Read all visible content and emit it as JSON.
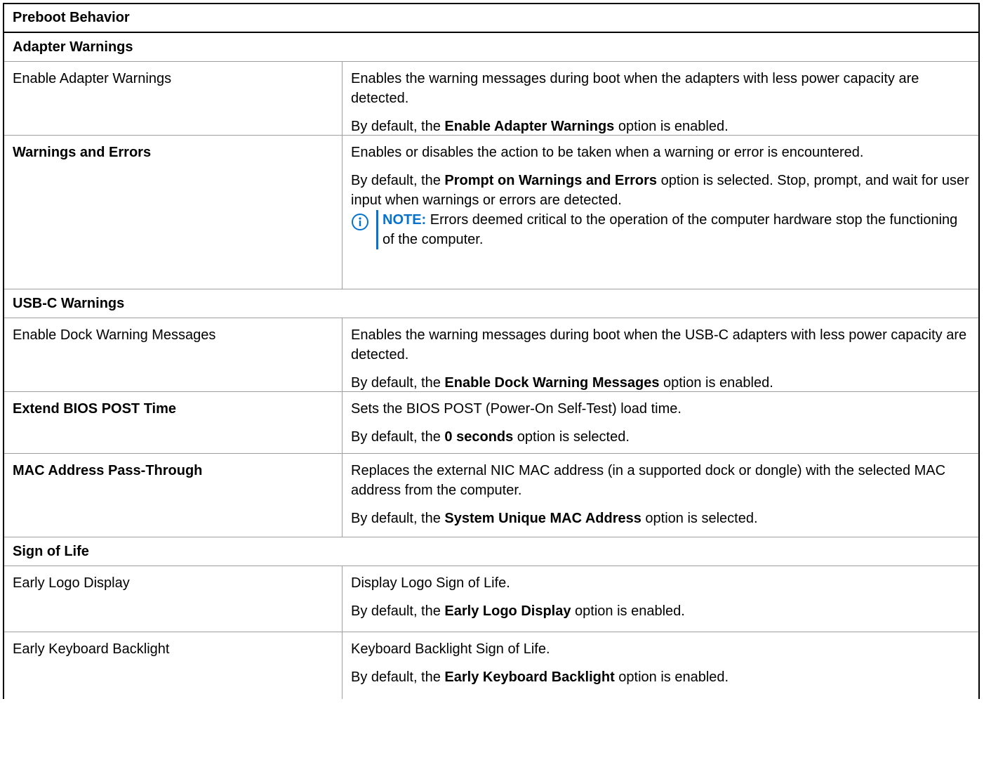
{
  "title": "Preboot Behavior",
  "colors": {
    "accent": "#0672cb",
    "border": "#000000",
    "divider": "#9e9e9e"
  },
  "adapter": {
    "heading": "Adapter Warnings",
    "item_label": "Enable Adapter Warnings",
    "desc": "Enables the warning messages during boot when the adapters with less power capacity are detected.",
    "default_prefix": "By default, the ",
    "default_bold": "Enable Adapter Warnings",
    "default_suffix": " option is enabled."
  },
  "warnings": {
    "label": "Warnings and Errors",
    "desc": "Enables or disables the action to be taken when a warning or error is encountered.",
    "default_prefix": "By default, the ",
    "default_bold": "Prompt on Warnings and Errors",
    "default_suffix": " option is selected. Stop, prompt, and wait for user input when warnings or errors are detected.",
    "note_icon": "info-icon",
    "note_label": "NOTE:",
    "note_text": " Errors deemed critical to the operation of the computer hardware stop the functioning of the computer."
  },
  "usbc": {
    "heading": "USB-C Warnings",
    "item_label": "Enable Dock Warning Messages",
    "desc": "Enables the warning messages during boot when the USB-C adapters with less power capacity are detected.",
    "default_prefix": "By default, the ",
    "default_bold": "Enable Dock Warning Messages",
    "default_suffix": " option is enabled."
  },
  "post": {
    "label": "Extend BIOS POST Time",
    "desc": "Sets the BIOS POST (Power-On Self-Test) load time.",
    "default_prefix": "By default, the ",
    "default_bold": "0 seconds",
    "default_suffix": " option is selected."
  },
  "mac": {
    "label": "MAC Address Pass-Through",
    "desc": "Replaces the external NIC MAC address (in a supported dock or dongle) with the selected MAC address from the computer.",
    "default_prefix": "By default, the ",
    "default_bold": "System Unique MAC Address",
    "default_suffix": " option is selected."
  },
  "sol": {
    "heading": "Sign of Life",
    "logo_label": "Early Logo Display",
    "logo_desc": "Display Logo Sign of Life.",
    "logo_default_prefix": "By default, the ",
    "logo_default_bold": "Early Logo Display",
    "logo_default_suffix": " option is enabled.",
    "kb_label": "Early Keyboard Backlight",
    "kb_desc": "Keyboard Backlight Sign of Life.",
    "kb_default_prefix": "By default, the ",
    "kb_default_bold": "Early Keyboard Backlight",
    "kb_default_suffix": " option is enabled."
  }
}
